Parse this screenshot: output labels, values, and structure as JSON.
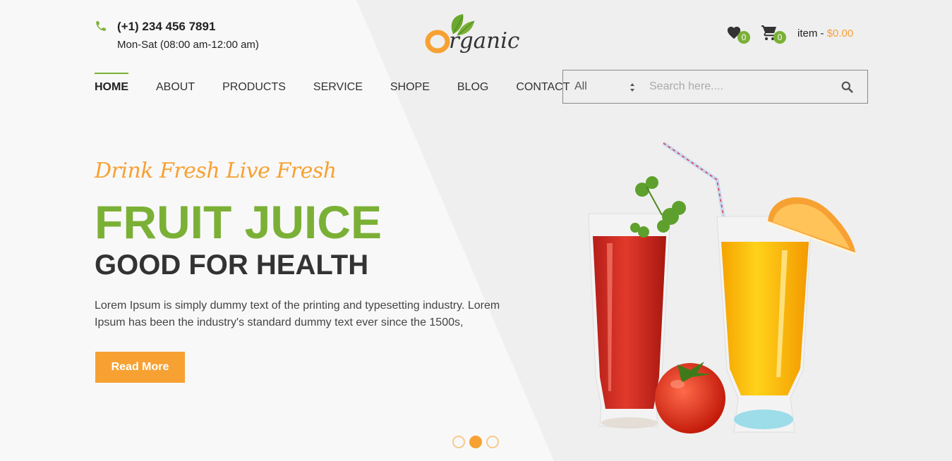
{
  "contact": {
    "phone": "(+1) 234 456 7891",
    "hours": "Mon-Sat (08:00 am-12:00 am)"
  },
  "logo": {
    "text": "rganic",
    "letter": "O"
  },
  "header": {
    "wishlist_count": "0",
    "cart_count": "0",
    "cart_label": "item - ",
    "cart_amount": "$0.00"
  },
  "nav": {
    "items": [
      {
        "label": "HOME"
      },
      {
        "label": "ABOUT"
      },
      {
        "label": "PRODUCTS"
      },
      {
        "label": "SERVICE"
      },
      {
        "label": "SHOPE"
      },
      {
        "label": "BLOG"
      },
      {
        "label": "CONTACT"
      }
    ],
    "active": "HOME"
  },
  "search": {
    "category": "All",
    "placeholder": "Search here...."
  },
  "hero": {
    "tagline": "Drink Fresh Live Fresh",
    "headline": "FRUIT JUICE",
    "subheadline": "GOOD FOR HEALTH",
    "body": "Lorem Ipsum is simply dummy text of the printing and typesetting industry. Lorem Ipsum has been the industry's standard dummy text ever since the 1500s,",
    "button": "Read More"
  },
  "slider": {
    "active_slide": 2,
    "total_slides": 3
  },
  "colors": {
    "accent_green": "#7bb036",
    "accent_orange": "#f7a133"
  }
}
